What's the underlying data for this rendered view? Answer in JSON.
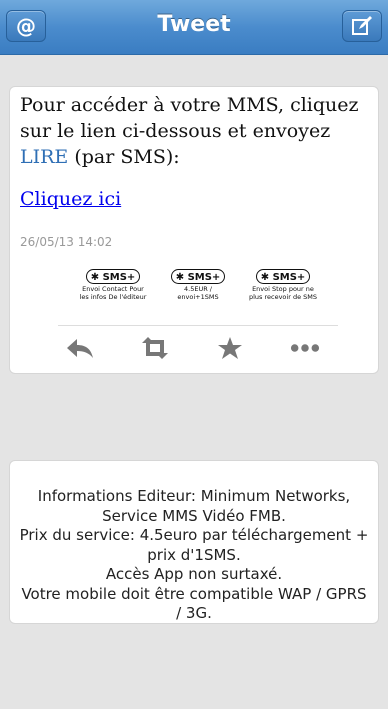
{
  "header": {
    "title": "Tweet",
    "left_button": "@",
    "right_button_icon": "compose-icon"
  },
  "tweet": {
    "text_before": "Pour accéder à votre MMS, cliquez sur le lien ci-dessous et envoyez ",
    "keyword": "LIRE",
    "text_after": " (par SMS):",
    "link_label": "Cliquez ici",
    "date": "26/05/13 14:02",
    "sms_buttons": [
      {
        "badge": "SMS+",
        "caption": "Envoi Contact Pour les infos De l'éditeur"
      },
      {
        "badge": "SMS+",
        "caption": "4.5EUR / envoi+1SMS"
      },
      {
        "badge": "SMS+",
        "caption": "Envoi Stop pour ne plus recevoir de SMS"
      }
    ],
    "actions": [
      "reply-icon",
      "retweet-icon",
      "star-icon",
      "more-icon"
    ]
  },
  "info": {
    "lines": [
      "Informations Editeur: Minimum Networks, Service MMS Vidéo FMB.",
      "Prix du service: 4.5euro par téléchargement + prix d'1SMS.",
      "Accès App non surtaxé.",
      "Votre mobile doit être compatible WAP / GPRS / 3G."
    ]
  },
  "colors": {
    "header": "#4b8ccd",
    "link": "#0000ee",
    "keyword": "#2f6fb5",
    "background": "#e4e4e4"
  }
}
